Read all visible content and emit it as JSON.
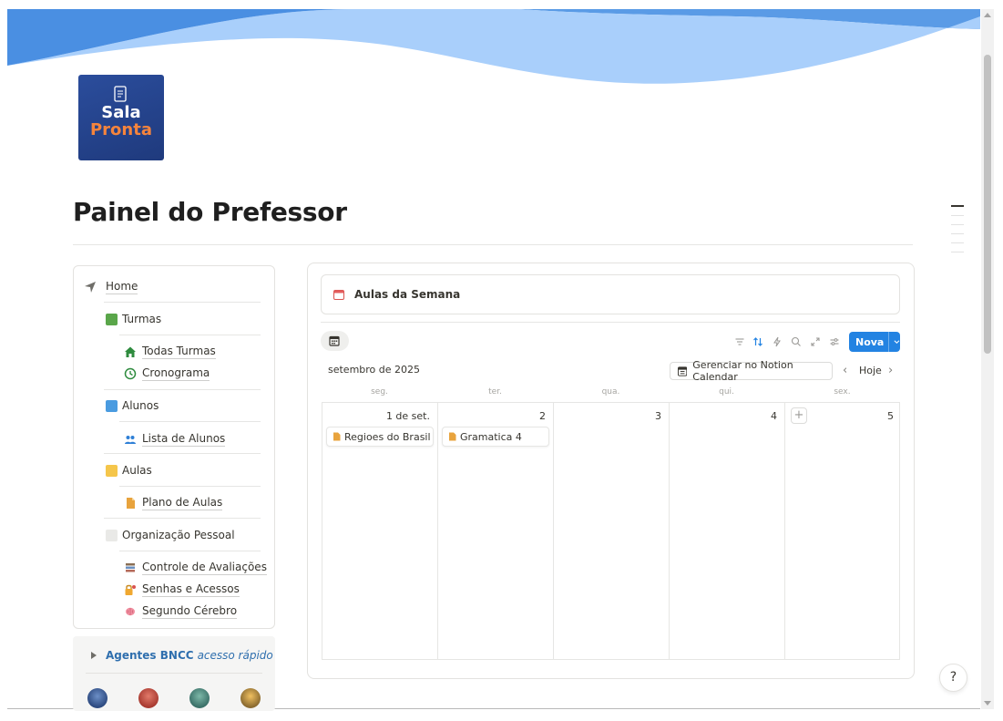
{
  "page": {
    "title": "Painel do Prefessor",
    "logo": {
      "line1": "Sala",
      "line2": "Pronta",
      "accent": "#f5843c",
      "bg": "#2b4d9c"
    }
  },
  "sidebar": {
    "home": "Home",
    "sections": [
      {
        "label": "Turmas",
        "color": "#5aa64a",
        "items": [
          {
            "label": "Todas Turmas",
            "icon": "house-icon"
          },
          {
            "label": "Cronograma",
            "icon": "clock-icon"
          }
        ]
      },
      {
        "label": "Alunos",
        "color": "#4a9be0",
        "items": [
          {
            "label": "Lista de Alunos",
            "icon": "people-icon"
          }
        ]
      },
      {
        "label": "Aulas",
        "color": "#f5c64b",
        "items": [
          {
            "label": "Plano de Aulas",
            "icon": "document-icon"
          }
        ]
      },
      {
        "label": "Organização Pessoal",
        "color": "#e6e6e4",
        "items": [
          {
            "label": "Controle de Avaliações",
            "icon": "books-icon"
          },
          {
            "label": "Senhas e Acessos",
            "icon": "lock-key-icon"
          },
          {
            "label": "Segundo Cérebro",
            "icon": "brain-icon"
          }
        ]
      }
    ]
  },
  "agents": {
    "label": "Agentes BNCC",
    "italic": "acesso rápido"
  },
  "calendar": {
    "block_title": "Aulas da Semana",
    "new_label": "Nova",
    "month": "setembro de 2025",
    "manage_label": "Gerenciar no Notion Calendar",
    "today_label": "Hoje",
    "weekdays": [
      "seg.",
      "ter.",
      "qua.",
      "qui.",
      "sex."
    ],
    "days": [
      {
        "num": "1 de set.",
        "event": "Regioes do Brasil"
      },
      {
        "num": "2",
        "event": "Gramatica 4"
      },
      {
        "num": "3",
        "event": null
      },
      {
        "num": "4",
        "event": null
      },
      {
        "num": "5",
        "event": null
      }
    ]
  },
  "help": {
    "label": "?"
  },
  "colors": {
    "accent": "#2383e2"
  }
}
